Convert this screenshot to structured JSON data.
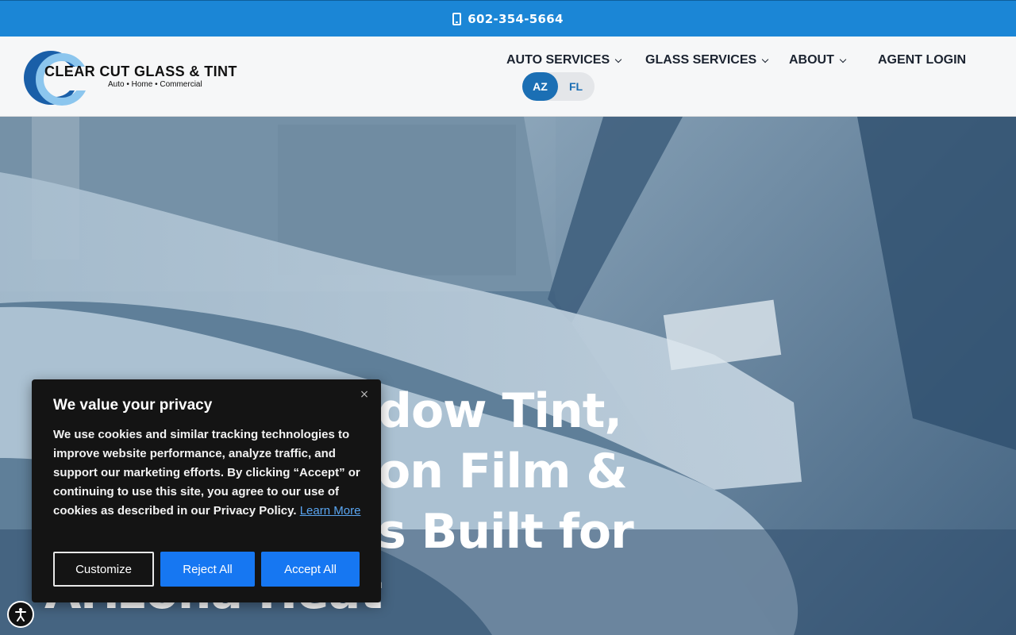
{
  "topbar": {
    "phone": "602-354-5664",
    "icon": "phone-icon"
  },
  "logo": {
    "name": "CLEAR CUT GLASS & TINT",
    "tagline": "Auto • Home • Commercial"
  },
  "nav": {
    "items": [
      {
        "label": "AUTO SERVICES",
        "has_dropdown": true
      },
      {
        "label": "GLASS SERVICES",
        "has_dropdown": true
      },
      {
        "label": "ABOUT",
        "has_dropdown": true
      },
      {
        "label": "AGENT LOGIN",
        "has_dropdown": false
      }
    ],
    "state_toggle": {
      "options": [
        "AZ",
        "FL"
      ],
      "selected": "AZ"
    }
  },
  "hero": {
    "lines": [
      "dow Tint,",
      "on Film &",
      "s Built for",
      "Arizona Heat"
    ]
  },
  "cookie": {
    "title": "We value your privacy",
    "body": "We use cookies and similar tracking technologies to improve website performance, analyze traffic, and support our marketing efforts. By clicking “Accept” or continuing to use this site, you agree to our use of cookies as described in our Privacy Policy.",
    "learn_more": "Learn More",
    "close": "×",
    "buttons": {
      "customize": "Customize",
      "reject": "Reject All",
      "accept": "Accept All"
    }
  },
  "colors": {
    "brand_blue": "#1b86d6",
    "button_blue": "#1677f2",
    "toggle_active": "#1b6fb4"
  }
}
